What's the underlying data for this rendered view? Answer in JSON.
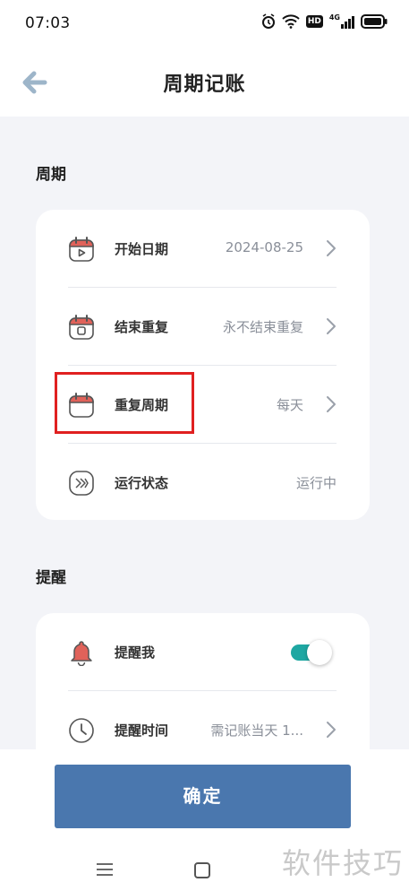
{
  "status_bar": {
    "time": "07:03",
    "icons": [
      "alarm-icon",
      "wifi-icon",
      "hd-icon",
      "signal-4g-icon",
      "battery-icon"
    ],
    "hd_label": "HD",
    "network_label": "4G"
  },
  "header": {
    "title": "周期记账",
    "back_icon": "arrow-left-icon"
  },
  "period_section": {
    "title": "周期",
    "rows": [
      {
        "label": "开始日期",
        "value": "2024-08-25",
        "icon": "calendar-play-icon"
      },
      {
        "label": "结束重复",
        "value": "永不结束重复",
        "icon": "calendar-stop-icon"
      },
      {
        "label": "重复周期",
        "value": "每天",
        "icon": "calendar-icon"
      },
      {
        "label": "运行状态",
        "value": "运行中",
        "icon": "fast-forward-icon"
      }
    ]
  },
  "reminder_section": {
    "title": "提醒",
    "rows": [
      {
        "label": "提醒我",
        "icon": "bell-icon",
        "toggle_on": true
      },
      {
        "label": "提醒时间",
        "value": "需记账当天 1...",
        "icon": "clock-icon"
      }
    ]
  },
  "footer": {
    "confirm_label": "确定",
    "watermark": "软件技巧"
  },
  "colors": {
    "accent_button": "#4a77ae",
    "toggle_on": "#1ea7a2",
    "icon_red": "#e0625a",
    "highlight": "#e02020"
  }
}
